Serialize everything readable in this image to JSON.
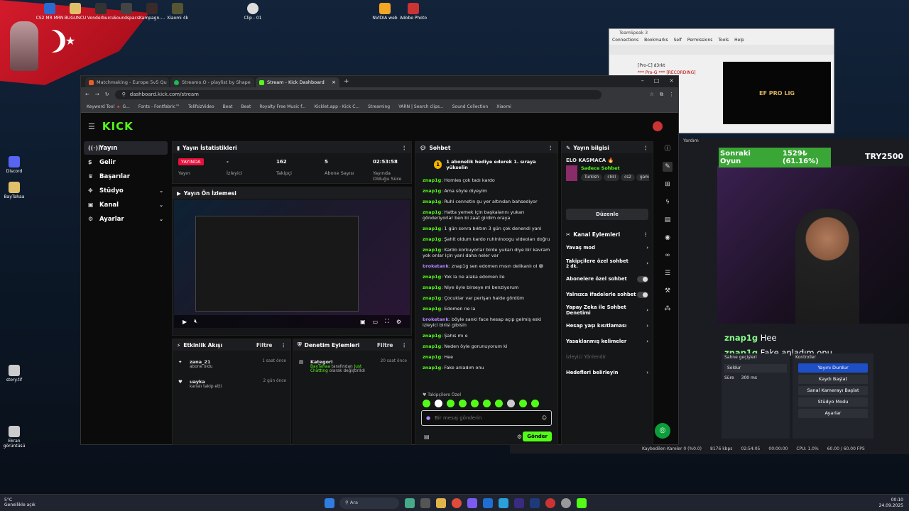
{
  "browser": {
    "tabs": [
      {
        "title": "Matchmaking - Europe 5v5 Qu"
      },
      {
        "title": "Streamo.O - playlist by Shape"
      },
      {
        "title": "Stream - Kick Dashboard"
      }
    ],
    "url": "dashboard.kick.com/stream",
    "bookmarks": [
      "Keyword Tool 🔺 G...",
      "Fonts - Fontfabric™",
      "TelifsizVideo",
      "Beat",
      "Beat",
      "Royalty Free Music f...",
      "Kicklet.app - Kick C...",
      "Streaming",
      "YARN | Search clips...",
      "Sound Collection",
      "Xiaomi"
    ]
  },
  "kick": {
    "logo": "KICK",
    "nav": [
      {
        "label": "Yayın",
        "icon": "broadcast-icon"
      },
      {
        "label": "Gelir",
        "icon": "dollar-icon"
      },
      {
        "label": "Başarılar",
        "icon": "trophy-icon"
      },
      {
        "label": "Stüdyo",
        "icon": "studio-icon"
      },
      {
        "label": "Kanal",
        "icon": "channel-icon"
      },
      {
        "label": "Ayarlar",
        "icon": "gear-icon"
      }
    ],
    "stats": {
      "title": "Yayın İstatistikleri",
      "live_badge": "YAYINDA",
      "live_label": "Yayın",
      "viewers_value": "-",
      "viewers_label": "İzleyici",
      "followers_value": "162",
      "followers_label": "Takipçi",
      "subs_value": "5",
      "subs_label": "Abone Sayısı",
      "uptime_value": "02:53:58",
      "uptime_label": "Yayında Olduğu Süre"
    },
    "preview": {
      "title": "Yayın Ön İzlemesi"
    },
    "activity": {
      "title": "Etkinlik Akışı",
      "filter": "Filtre",
      "items": [
        {
          "user": "zana_21",
          "text": "abone oldu",
          "time": "1 saat önce"
        },
        {
          "user": "uayka",
          "text": "kanalı takip etti",
          "time": "2 gün önce"
        }
      ]
    },
    "moderation": {
      "title": "Denetim Eylemleri",
      "filter": "Filtre",
      "item_title": "Kategori",
      "item_time": "20 saat önce",
      "item_user": "BayTahaa",
      "item_mid": "tarafından",
      "item_cat": "Just Chatting",
      "item_tail": "olarak değiştirildi"
    },
    "chat": {
      "title": "Sohbet",
      "pinned": "1 abonelik hediye ederek 1. sıraya yükselin",
      "messages": [
        {
          "user": "znap1g",
          "text": "Homies çok tadı kardo",
          "purple": false
        },
        {
          "user": "znap1g",
          "text": "Ama söyle diyeyim",
          "purple": false
        },
        {
          "user": "znap1g",
          "text": "Ruhi cennetin şu yer altından bahsediyor",
          "purple": false
        },
        {
          "user": "znap1g",
          "text": "Hatta yemek için başkalarını yukarı gönderiyorlar ben bi zaat girdim oraya",
          "purple": false
        },
        {
          "user": "znap1g",
          "text": "1 gün sonra bıktım 3 gün çok denendi yani",
          "purple": false
        },
        {
          "user": "znap1g",
          "text": "Şahit oldum kardo ruhininoogu videoları doğru",
          "purple": false
        },
        {
          "user": "znap1g",
          "text": "Kardo korkuyorlar birde yukarı diye bir kavram yok onlar için yani daha neler var",
          "purple": false
        },
        {
          "user": "broketank",
          "text": "znap1g sen edomen mısın delikanlı ol 😁",
          "purple": true
        },
        {
          "user": "znap1g",
          "text": "Yok la ne alaka edomen ile",
          "purple": false
        },
        {
          "user": "znap1g",
          "text": "Niye öyle birseye mi benziyorum",
          "purple": false
        },
        {
          "user": "znap1g",
          "text": "Çocuklar var perişan halde gördüm",
          "purple": false
        },
        {
          "user": "znap1g",
          "text": "Edomen ne la",
          "purple": false
        },
        {
          "user": "broketank",
          "text": "böyle sanki face hesap açıp gelmiş eski izleyici birisi gibisin",
          "purple": true
        },
        {
          "user": "znap1g",
          "text": "Şahıs mı e",
          "purple": false
        },
        {
          "user": "znap1g",
          "text": "Neden öyle gorunuyorum ki",
          "purple": false
        },
        {
          "user": "znap1g",
          "text": "Hee",
          "purple": false
        },
        {
          "user": "znap1g",
          "text": "Fake anladım onu",
          "purple": false
        }
      ],
      "followers_only": "Takipçilere Özel",
      "placeholder": "Bir mesaj gönderin",
      "send": "Gönder"
    },
    "info": {
      "title": "Yayın bilgisi",
      "stream_title": "ELO KASMACA 🔥",
      "category": "Sadece Sohbet",
      "tags": [
        "Turkish",
        "chill",
        "cs2",
        "gami"
      ],
      "edit": "Düzenle",
      "channel_actions": "Kanal Eylemleri",
      "settings": [
        {
          "label": "Yavaş mod",
          "kind": "chevron"
        },
        {
          "label": "Takipçilere özel sohbet",
          "sub": "2 dk.",
          "kind": "chevron"
        },
        {
          "label": "Abonelere özel sohbet",
          "kind": "toggle"
        },
        {
          "label": "Yalnızca ifadelerle sohbet",
          "kind": "toggle"
        },
        {
          "label": "Yapay Zeka ile Sohbet Denetimi",
          "kind": "chevron"
        },
        {
          "label": "Hesap yaşı kısıtlaması",
          "kind": "chevron"
        },
        {
          "label": "Yasaklanmış kelimeler",
          "kind": "chevron"
        },
        {
          "label": "İzleyici Yönlendir",
          "kind": "none"
        },
        {
          "label": "Hedefleri belirleyin",
          "kind": "chevron"
        }
      ]
    }
  },
  "teamspeak": {
    "title": "TeamSpeak 3",
    "menu": [
      "Connections",
      "Bookmarks",
      "Self",
      "Permissions",
      "Tools",
      "Help"
    ],
    "channels": [
      "[Pro-C] d3rkt",
      "*** Pro-G *** [RECORDING]"
    ],
    "banner": "EF PRO LIG"
  },
  "obs": {
    "menu_label": "Yardım",
    "next_game": "Sonraki Oyun",
    "next_percent": "1529₺ (61.16%)",
    "goal": "TRY2500",
    "overlay_chat": [
      {
        "user": "znap1g",
        "text": "Hee"
      },
      {
        "user": "znap1g",
        "text": "Fake anladım onu"
      }
    ],
    "transitions_title": "Sahne geçişleri",
    "transition": "Soldur",
    "duration_label": "Süre",
    "duration": "300 ms",
    "controls_title": "Kontroller",
    "controls": [
      "Yayını Durdur",
      "Kaydı Başlat",
      "Sanal Kamerayı Başlat",
      "Stüdyo Modu",
      "Ayarlar"
    ],
    "status": [
      "Kaybedilen Kareler 0 (%0.0)",
      "8176 kbps",
      "02:54:05",
      "00:00:00",
      "CPU: 1.0%",
      "60.00 / 60.00 FPS"
    ]
  },
  "desktop_icons": [
    {
      "label": "CS2 MR MRN"
    },
    {
      "label": "BUGUNCU"
    },
    {
      "label": "Vonderburcu"
    },
    {
      "label": "Soundspacs"
    },
    {
      "label": "Kampagn-..."
    },
    {
      "label": "Xiaomi 4k"
    },
    {
      "label": "Clip - 01"
    },
    {
      "label": "NVIDIA web"
    },
    {
      "label": "Adobe Photo"
    },
    {
      "label": "BayTahaa"
    },
    {
      "label": "Discord"
    },
    {
      "label": "Ekran görüntüsü"
    },
    {
      "label": "story.tif"
    }
  ],
  "taskbar": {
    "weather": "5°C",
    "weather_sub": "Genellikle açık",
    "search": "Ara",
    "time": "00:10",
    "date": "24.09.2025"
  }
}
